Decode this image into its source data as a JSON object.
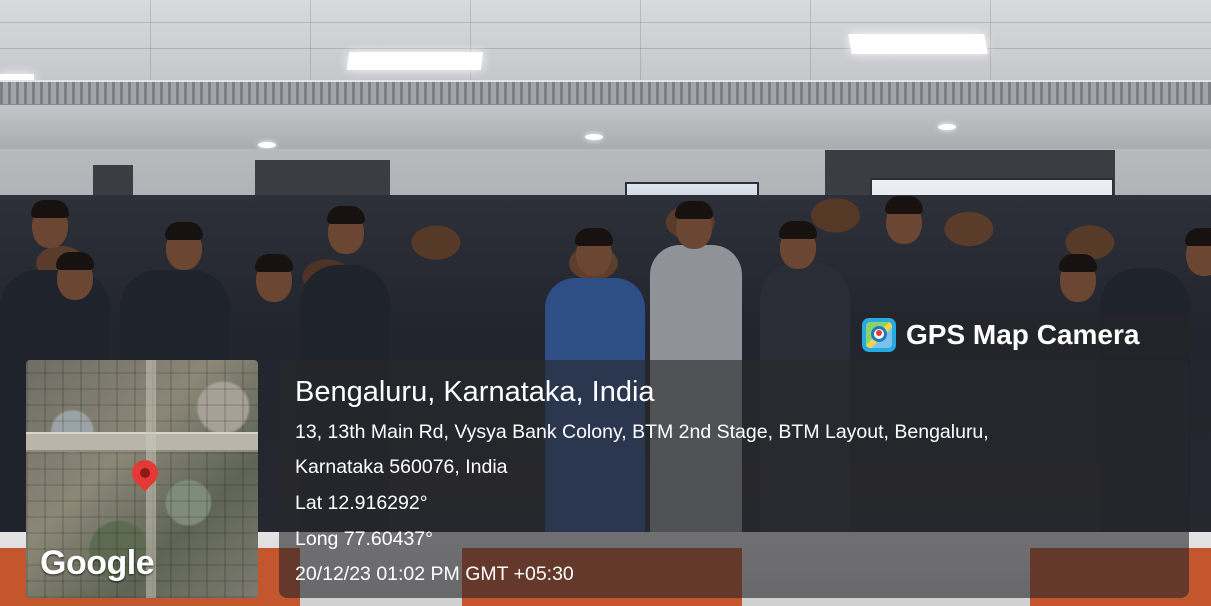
{
  "app": {
    "name": "GPS Map Camera"
  },
  "location": {
    "title": "Bengaluru, Karnataka, India",
    "address_line1": "13, 13th Main Rd, Vysya Bank Colony, BTM 2nd Stage, BTM Layout, Bengaluru,",
    "address_line2": "Karnataka 560076, India",
    "latitude": "Lat 12.916292°",
    "longitude": "Long 77.60437°",
    "timestamp": "20/12/23 01:02 PM GMT +05:30"
  },
  "map": {
    "provider_logo": "Google",
    "marker_icon": "location-pin-icon",
    "marker_color": "#e53935"
  },
  "colors": {
    "overlay": "#28282c",
    "text": "#ffffff",
    "app_icon": "#27a9e1"
  }
}
